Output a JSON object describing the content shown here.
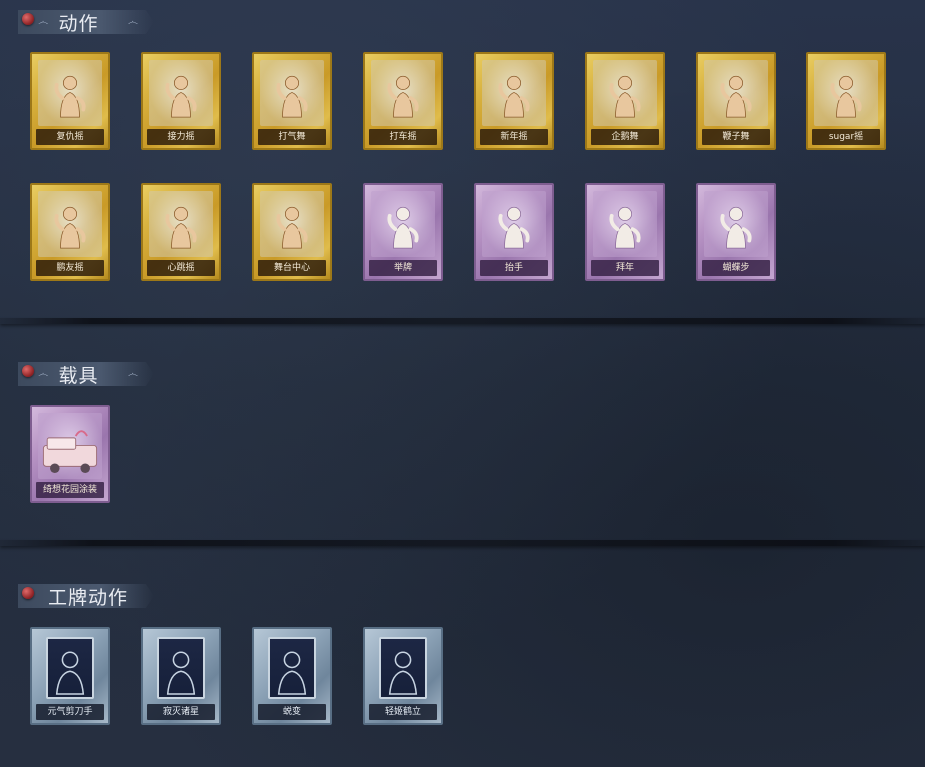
{
  "sections": [
    {
      "title": "动作"
    },
    {
      "title": "载具"
    },
    {
      "title": "工牌动作"
    }
  ],
  "actions": [
    {
      "label": "复仇摇",
      "rarity": "gold"
    },
    {
      "label": "接力摇",
      "rarity": "gold"
    },
    {
      "label": "打气舞",
      "rarity": "gold"
    },
    {
      "label": "打车摇",
      "rarity": "gold"
    },
    {
      "label": "新年摇",
      "rarity": "gold"
    },
    {
      "label": "企鹅舞",
      "rarity": "gold"
    },
    {
      "label": "鞭子舞",
      "rarity": "gold"
    },
    {
      "label": "sugar摇",
      "rarity": "gold"
    },
    {
      "label": "鹏友摇",
      "rarity": "gold"
    },
    {
      "label": "心跳摇",
      "rarity": "gold"
    },
    {
      "label": "舞台中心",
      "rarity": "gold"
    },
    {
      "label": "举牌",
      "rarity": "purple"
    },
    {
      "label": "抬手",
      "rarity": "purple"
    },
    {
      "label": "拜年",
      "rarity": "purple"
    },
    {
      "label": "蝴蝶步",
      "rarity": "purple"
    }
  ],
  "vehicles": [
    {
      "label": "绮想花园涂装",
      "rarity": "purple"
    }
  ],
  "badge_actions": [
    {
      "label": "元气剪刀手",
      "rarity": "blue"
    },
    {
      "label": "寂灭诸星",
      "rarity": "blue"
    },
    {
      "label": "蜕变",
      "rarity": "blue"
    },
    {
      "label": "轻姬鹤立",
      "rarity": "blue"
    }
  ],
  "colors": {
    "background": "#253041",
    "gold": "#d9b340",
    "purple": "#b793c4",
    "blue": "#8ea4b8",
    "pin": "#b83a3e"
  }
}
